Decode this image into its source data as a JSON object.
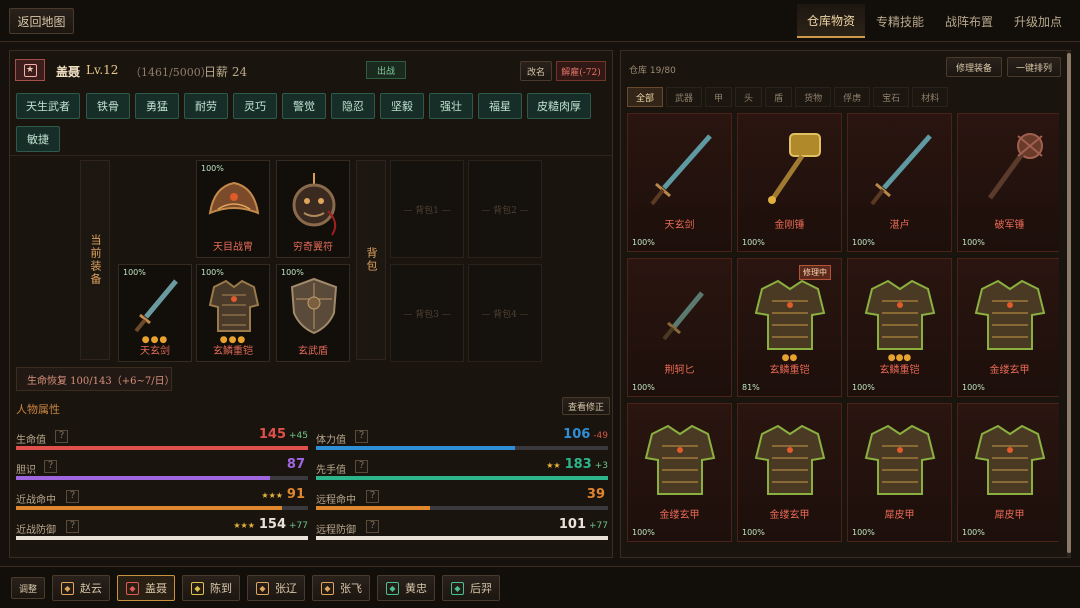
{
  "topbar": {
    "back_label": "返回地图",
    "tabs": [
      "仓库物资",
      "专精技能",
      "战阵布置",
      "升级加点"
    ]
  },
  "character": {
    "name": "盖聂",
    "level": "Lv.12",
    "exp": "（1461/5000）",
    "pay": "日薪 24",
    "deploy_label": "出战",
    "rename_label": "改名",
    "dismiss_label": "解雇(-72)",
    "traits": [
      "天生武者",
      "铁骨",
      "勇猛",
      "耐劳",
      "灵巧",
      "警觉",
      "隐忍",
      "坚毅",
      "强壮",
      "福星",
      "皮糙肉厚",
      "敏捷"
    ]
  },
  "equipment": {
    "current_label": "当前装备",
    "bag_label": "背包",
    "slots": [
      {
        "name": "天目战冑",
        "pct": "100%",
        "dots": "",
        "icon": "helmet-icon"
      },
      {
        "name": "穷奇翼符",
        "pct": "",
        "dots": "",
        "icon": "amulet-icon"
      },
      {
        "name": "天玄剑",
        "pct": "100%",
        "dots": "●●●",
        "icon": "sword-icon"
      },
      {
        "name": "玄鳞重铠",
        "pct": "100%",
        "dots": "●●●",
        "icon": "armor-icon"
      },
      {
        "name": "玄武盾",
        "pct": "100%",
        "dots": "",
        "icon": "shield-icon"
      }
    ],
    "bags": [
      "— 背包1 —",
      "— 背包2 —",
      "— 背包3 —",
      "— 背包4 —"
    ]
  },
  "regen": "生命恢复 100/143（+6~7/日）",
  "attributes": {
    "title": "人物属性",
    "check_label": "查看修正",
    "help": "?",
    "stats": [
      {
        "label": "生命值",
        "value": "145",
        "delta": "+45",
        "stars": "",
        "color": "#e1504a",
        "delta_color": "#6fc58a",
        "fill": 1.0
      },
      {
        "label": "体力值",
        "value": "106",
        "delta": "-49",
        "stars": "",
        "color": "#2f8fd6",
        "delta_color": "#d05545",
        "fill": 0.68
      },
      {
        "label": "胆识",
        "value": "87",
        "delta": "",
        "stars": "",
        "color": "#a066e0",
        "delta_color": "",
        "fill": 0.87
      },
      {
        "label": "先手值",
        "value": "183",
        "delta": "+3",
        "stars": "★★",
        "color": "#2cb48a",
        "delta_color": "#6fc58a",
        "fill": 1.0
      },
      {
        "label": "近战命中",
        "value": "91",
        "delta": "",
        "stars": "★★★",
        "color": "#e0862e",
        "delta_color": "",
        "fill": 0.91
      },
      {
        "label": "远程命中",
        "value": "39",
        "delta": "",
        "stars": "",
        "color": "#e0862e",
        "delta_color": "",
        "fill": 0.39
      },
      {
        "label": "近战防御",
        "value": "154",
        "delta": "+77",
        "stars": "★★★",
        "color": "#e8e2d8",
        "delta_color": "#6fc58a",
        "fill": 1.0
      },
      {
        "label": "远程防御",
        "value": "101",
        "delta": "+77",
        "stars": "",
        "color": "#e8e2d8",
        "delta_color": "#6fc58a",
        "fill": 1.0
      }
    ]
  },
  "warehouse": {
    "count": "仓库 19/80",
    "repair_label": "修理装备",
    "sort_label": "一键排列",
    "filters": [
      "全部",
      "武器",
      "甲",
      "头",
      "盾",
      "货物",
      "俘虏",
      "宝石",
      "材料"
    ],
    "items": [
      {
        "name": "天玄剑",
        "pct": "100%",
        "dots": "",
        "badge": "",
        "icon": "sword-icon"
      },
      {
        "name": "金刚锤",
        "pct": "100%",
        "dots": "",
        "badge": "",
        "icon": "hammer-icon"
      },
      {
        "name": "湛卢",
        "pct": "100%",
        "dots": "",
        "badge": "",
        "icon": "sword-icon"
      },
      {
        "name": "破军锤",
        "pct": "100%",
        "dots": "",
        "badge": "",
        "icon": "mace-icon"
      },
      {
        "name": "荆轲匕",
        "pct": "100%",
        "dots": "",
        "badge": "",
        "icon": "dagger-icon"
      },
      {
        "name": "玄鳞重铠",
        "pct": "81%",
        "dots": "●●",
        "badge": "修理中",
        "icon": "armor-icon"
      },
      {
        "name": "玄鳞重铠",
        "pct": "100%",
        "dots": "●●●",
        "badge": "",
        "icon": "armor-icon"
      },
      {
        "name": "金缕玄甲",
        "pct": "100%",
        "dots": "",
        "badge": "",
        "icon": "armor-icon"
      },
      {
        "name": "金缕玄甲",
        "pct": "100%",
        "dots": "",
        "badge": "",
        "icon": "armor-icon"
      },
      {
        "name": "金缕玄甲",
        "pct": "100%",
        "dots": "",
        "badge": "",
        "icon": "armor-icon"
      },
      {
        "name": "犀皮甲",
        "pct": "100%",
        "dots": "",
        "badge": "",
        "icon": "armor-icon"
      },
      {
        "name": "犀皮甲",
        "pct": "100%",
        "dots": "",
        "badge": "",
        "icon": "armor-icon"
      }
    ]
  },
  "bottombar": {
    "adjust_label": "调整",
    "heroes": [
      {
        "name": "赵云",
        "color": "#e0a45c"
      },
      {
        "name": "盖聂",
        "color": "#e05a5a"
      },
      {
        "name": "陈到",
        "color": "#e0c24a"
      },
      {
        "name": "张辽",
        "color": "#e0a45c"
      },
      {
        "name": "张飞",
        "color": "#e0a45c"
      },
      {
        "name": "黄忠",
        "color": "#4ac08a"
      },
      {
        "name": "后羿",
        "color": "#4ac08a"
      }
    ]
  }
}
